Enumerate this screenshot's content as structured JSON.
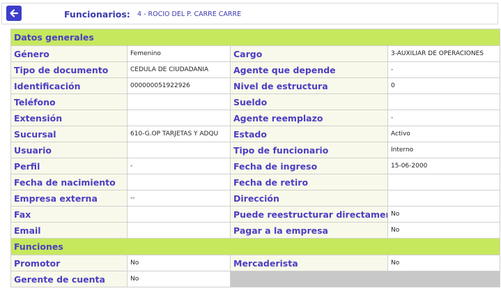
{
  "header": {
    "back_icon": "arrow-left-icon",
    "title_label": "Funcionarios:",
    "employee": "4 - ROCIO DEL P. CARRE CARRE"
  },
  "colors": {
    "section_bg": "#c6e85d",
    "label_text": "#4b3dc4",
    "label_bg": "#f8f9ea",
    "back_button": "#3d3dcc"
  },
  "general": {
    "title": "Datos generales",
    "rows": [
      {
        "l1": "Género",
        "v1": "Femenino",
        "l2": "Cargo",
        "v2": "3-AUXILIAR DE OPERACIONES"
      },
      {
        "l1": "Tipo de documento",
        "v1": "CEDULA DE CIUDADANIA",
        "l2": "Agente que depende",
        "v2": "-"
      },
      {
        "l1": "Identificación",
        "v1": "000000051922926",
        "l2": "Nivel de estructura",
        "v2": "0"
      },
      {
        "l1": "Teléfono",
        "v1": "",
        "l2": "Sueldo",
        "v2": ""
      },
      {
        "l1": "Extensión",
        "v1": "",
        "l2": "Agente reemplazo",
        "v2": "-"
      },
      {
        "l1": "Sucursal",
        "v1": "610-G.OP TARJETAS Y ADQU",
        "l2": "Estado",
        "v2": "Activo"
      },
      {
        "l1": "Usuario",
        "v1": "",
        "l2": "Tipo de funcionario",
        "v2": "Interno"
      },
      {
        "l1": "Perfil",
        "v1": "-",
        "l2": "Fecha de ingreso",
        "v2": "15-06-2000"
      },
      {
        "l1": "Fecha de nacimiento",
        "v1": "",
        "l2": "Fecha de retiro",
        "v2": ""
      },
      {
        "l1": "Empresa externa",
        "v1": "--",
        "l2": "Dirección",
        "v2": ""
      },
      {
        "l1": "Fax",
        "v1": "",
        "l2": "Puede reestructurar directamente",
        "v2": "No"
      },
      {
        "l1": "Email",
        "v1": "",
        "l2": "Pagar a la empresa",
        "v2": "No"
      }
    ]
  },
  "functions": {
    "title": "Funciones",
    "row1": {
      "l1": "Promotor",
      "v1": "No",
      "l2": "Mercaderista",
      "v2": "No"
    },
    "row2": {
      "l1": "Gerente de cuenta",
      "v1": "No"
    }
  }
}
